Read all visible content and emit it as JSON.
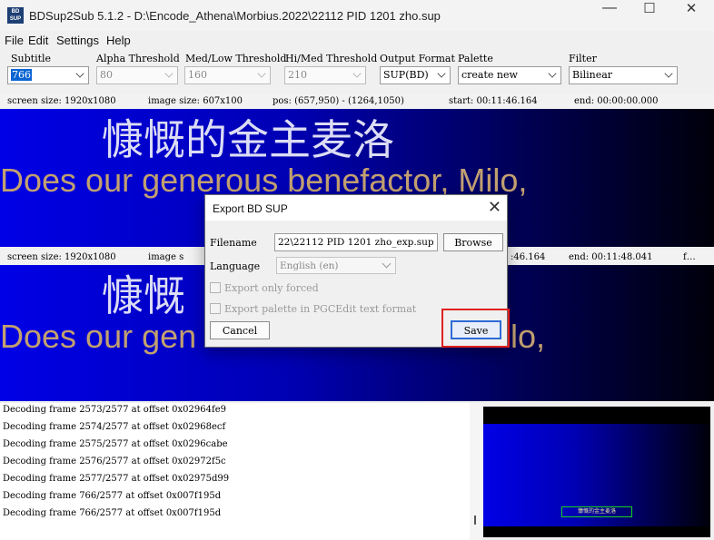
{
  "window": {
    "app_icon_text": "BD SUP",
    "title": "BDSup2Sub 5.1.2 - D:\\Encode_Athena\\Morbius.2022\\22112 PID 1201 zho.sup",
    "minimize": "—",
    "maximize": "☐",
    "close": "✕"
  },
  "menu": [
    "File",
    "Edit",
    "Settings",
    "Help"
  ],
  "toolbar": {
    "subtitle": {
      "label": "Subtitle",
      "value": "766"
    },
    "alpha": {
      "label": "Alpha Threshold",
      "value": "80"
    },
    "medlow": {
      "label": "Med/Low Threshold",
      "value": "160"
    },
    "himed": {
      "label": "Hi/Med Threshold",
      "value": "210"
    },
    "output": {
      "label": "Output Format",
      "value": "SUP(BD)"
    },
    "palette": {
      "label": "Palette",
      "value": "create new"
    },
    "filter": {
      "label": "Filter",
      "value": "Bilinear"
    }
  },
  "source_info": {
    "screen": "screen size: 1920x1080",
    "image": "image size: 607x100",
    "pos": "pos: (657,950) - (1264,1050)",
    "start": "start: 00:11:46.164",
    "end": "end: 00:00:00.000"
  },
  "target_info": {
    "screen": "screen size: 1920x1080",
    "image": "image s",
    "start": ":46.164",
    "end": "end: 00:11:48.041",
    "more": "f…"
  },
  "subtitle_text": {
    "zh": "慷慨的金主麦洛",
    "zh_partial": "慷慨",
    "en": "Does our generous benefactor, Milo,",
    "en_left": "Does our gen",
    "en_right": "ilo,"
  },
  "log": [
    "Decoding frame 2573/2577 at offset 0x02964fe9",
    "Decoding frame 2574/2577 at offset 0x02968ecf",
    "Decoding frame 2575/2577 at offset 0x0296cabe",
    "Decoding frame 2576/2577 at offset 0x02972f5c",
    "Decoding frame 2577/2577 at offset 0x02975d99",
    "Decoding frame 766/2577 at offset 0x007f195d",
    "Decoding frame 766/2577 at offset 0x007f195d"
  ],
  "preview": {
    "subtitle": "慷慨的金主麦洛"
  },
  "dialog": {
    "title": "Export BD SUP",
    "close": "✕",
    "filename_label": "Filename",
    "filename_value": "22\\22112 PID 1201 zho_exp.sup",
    "browse": "Browse",
    "language_label": "Language",
    "language_value": "English (en)",
    "export_forced": "Export only forced",
    "export_palette": "Export palette in PGCEdit text format",
    "cancel": "Cancel",
    "save": "Save"
  }
}
